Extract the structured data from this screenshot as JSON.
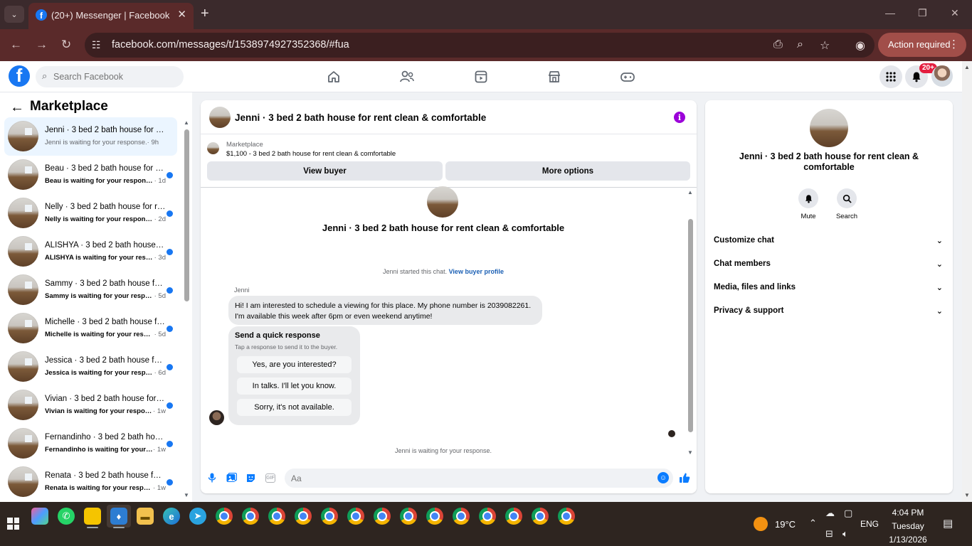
{
  "browser": {
    "tab_title": "(20+) Messenger | Facebook",
    "url": "facebook.com/messages/t/1538974927352368/#fua",
    "action_required": "Action required"
  },
  "fb_header": {
    "logo": "f",
    "search_placeholder": "Search Facebook",
    "notification_badge": "20+"
  },
  "left_panel": {
    "title": "Marketplace",
    "conversations": [
      {
        "name": "Jenni · 3 bed 2 bath house for rent clean & comfortable",
        "preview": "Jenni is waiting for your response.",
        "time": " · 9h",
        "unread": false,
        "active": true
      },
      {
        "name": "Beau · 3 bed 2 bath house for rent clean & comfortable",
        "preview": "Beau is waiting for your response.",
        "time": " · 1d",
        "unread": true,
        "active": false
      },
      {
        "name": "Nelly · 3 bed 2 bath house for rent clean & comfortable",
        "preview": "Nelly is waiting for your response.",
        "time": " · 2d",
        "unread": true,
        "active": false
      },
      {
        "name": "ALISHYA · 3 bed 2 bath house for rent clean & comfortable",
        "preview": "ALISHYA is waiting for your response.",
        "time": " · 3d",
        "unread": true,
        "active": false
      },
      {
        "name": "Sammy · 3 bed 2 bath house for rent clean & comfortable",
        "preview": "Sammy is waiting for your response.",
        "time": " · 5d",
        "unread": true,
        "active": false
      },
      {
        "name": "Michelle · 3 bed 2 bath house for rent clean & comfortable",
        "preview": "Michelle is waiting for your response.",
        "time": " · 5d",
        "unread": true,
        "active": false
      },
      {
        "name": "Jessica · 3 bed 2 bath house for rent clean & comfortable",
        "preview": "Jessica is waiting for your response.",
        "time": " · 6d",
        "unread": true,
        "active": false
      },
      {
        "name": "Vivian · 3 bed 2 bath house for rent clean & comfortable",
        "preview": "Vivian is waiting for your response.",
        "time": " · 1w",
        "unread": true,
        "active": false
      },
      {
        "name": "Fernandinho · 3 bed 2 bath house for rent clean & comfortable",
        "preview": "Fernandinho is waiting for your response.",
        "time": " · 1w",
        "unread": true,
        "active": false
      },
      {
        "name": "Renata · 3 bed 2 bath house for rent clean & comfortable",
        "preview": "Renata is waiting for your response.",
        "time": " · 1w",
        "unread": true,
        "active": false
      }
    ]
  },
  "chat": {
    "header_title": "Jenni · 3 bed 2 bath house for rent clean & comfortable",
    "marketplace_label": "Marketplace",
    "listing": "$1,100 - 3 bed 2 bath house for rent clean & comfortable",
    "view_buyer": "View buyer",
    "more_options": "More options",
    "center_name": "Jenni · 3 bed 2 bath house for rent clean & comfortable",
    "started_text": "Jenni started this chat. ",
    "view_buyer_profile": "View buyer profile",
    "sender_name": "Jenni",
    "message": "Hi! I am interested to schedule a viewing for this place. My phone number is 2039082261. I'm available this week after 6pm or even weekend anytime!",
    "quick_response_title": "Send a quick response",
    "quick_response_hint": "Tap a response to send it to the buyer.",
    "quick_responses": [
      "Yes, are you interested?",
      "In talks. I'll let you know.",
      "Sorry, it's not available."
    ],
    "waiting_text": "Jenni is waiting for your response.",
    "composer_placeholder": "Aa",
    "gif_label": "GIF"
  },
  "info_panel": {
    "name": "Jenni · 3 bed 2 bath house for rent clean & comfortable",
    "mute": "Mute",
    "search": "Search",
    "sections": [
      "Customize chat",
      "Chat members",
      "Media, files and links",
      "Privacy & support"
    ]
  },
  "taskbar": {
    "temperature": "19°C",
    "language": "ENG",
    "time": "4:04 PM",
    "day": "Tuesday",
    "date": "1/13/2026"
  },
  "colors": {
    "brand": "#1877f2",
    "messenger_blue": "#0a7cff",
    "info_purple": "#9b00d9",
    "chrome_frame": "#5a2a2a"
  }
}
